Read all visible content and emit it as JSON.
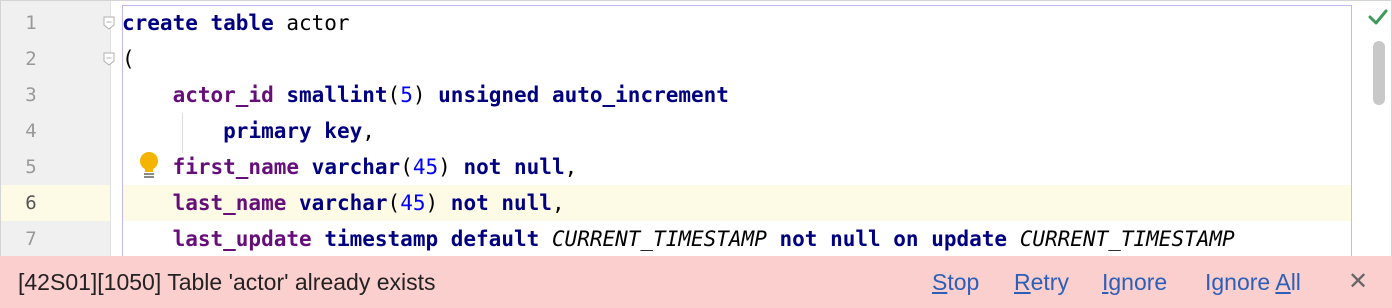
{
  "editor": {
    "line_numbers": [
      "1",
      "2",
      "3",
      "4",
      "5",
      "6",
      "7"
    ],
    "current_line": "6",
    "code_lines": [
      [
        {
          "t": "create table",
          "c": "kw"
        },
        {
          "t": " actor",
          "c": ""
        }
      ],
      [
        {
          "t": "(",
          "c": ""
        }
      ],
      [
        {
          "t": "    ",
          "c": ""
        },
        {
          "t": "actor_id",
          "c": "ident"
        },
        {
          "t": " ",
          "c": ""
        },
        {
          "t": "smallint",
          "c": "kw"
        },
        {
          "t": "(",
          "c": ""
        },
        {
          "t": "5",
          "c": "num"
        },
        {
          "t": ") ",
          "c": ""
        },
        {
          "t": "unsigned auto_increment",
          "c": "kw"
        }
      ],
      [
        {
          "t": "        ",
          "c": ""
        },
        {
          "t": "primary key",
          "c": "kw"
        },
        {
          "t": ",",
          "c": ""
        }
      ],
      [
        {
          "t": "    ",
          "c": ""
        },
        {
          "t": "first_name",
          "c": "ident"
        },
        {
          "t": " ",
          "c": ""
        },
        {
          "t": "varchar",
          "c": "kw"
        },
        {
          "t": "(",
          "c": ""
        },
        {
          "t": "45",
          "c": "num"
        },
        {
          "t": ") ",
          "c": ""
        },
        {
          "t": "not null",
          "c": "kw"
        },
        {
          "t": ",",
          "c": ""
        }
      ],
      [
        {
          "t": "    ",
          "c": ""
        },
        {
          "t": "last_name",
          "c": "ident"
        },
        {
          "t": " ",
          "c": ""
        },
        {
          "t": "varchar",
          "c": "kw"
        },
        {
          "t": "(",
          "c": ""
        },
        {
          "t": "45",
          "c": "num"
        },
        {
          "t": ") ",
          "c": ""
        },
        {
          "t": "not null",
          "c": "kw"
        },
        {
          "t": ",",
          "c": ""
        }
      ],
      [
        {
          "t": "    ",
          "c": ""
        },
        {
          "t": "last_update",
          "c": "ident"
        },
        {
          "t": " ",
          "c": ""
        },
        {
          "t": "timestamp default",
          "c": "kw"
        },
        {
          "t": " ",
          "c": ""
        },
        {
          "t": "CURRENT_TIMESTAMP",
          "c": "it"
        },
        {
          "t": " ",
          "c": ""
        },
        {
          "t": "not null on update",
          "c": "kw"
        },
        {
          "t": " ",
          "c": ""
        },
        {
          "t": "CURRENT_TIMESTAMP",
          "c": "it"
        }
      ]
    ]
  },
  "error_bar": {
    "message": "[42S01][1050] Table 'actor' already exists",
    "stop": {
      "mnemonic": "S",
      "rest": "top"
    },
    "retry": {
      "mnemonic": "R",
      "rest": "etry"
    },
    "ignore": {
      "mnemonic": "I",
      "rest": "gnore"
    },
    "ignore_all": {
      "before": "Ignore ",
      "mnemonic": "A",
      "rest": "ll"
    },
    "close_glyph": "✕"
  },
  "colors": {
    "keyword": "#000080",
    "identifier": "#660e7a",
    "number": "#0000ff",
    "error_background": "#fbcfcd",
    "link": "#2b5fb8",
    "current_line": "#fdfbe6"
  },
  "icons": {
    "inspection_status": "checkmark-icon",
    "intention": "lightbulb-icon",
    "fold": "fold-marker-icon",
    "close": "close-icon"
  }
}
